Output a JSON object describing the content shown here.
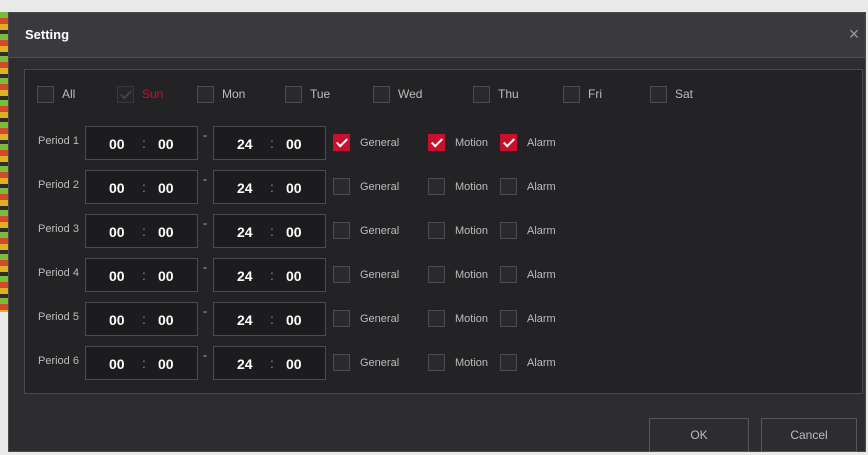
{
  "dialog": {
    "title": "Setting",
    "close_icon": "close-icon"
  },
  "days": [
    {
      "label": "All",
      "checked": false,
      "active": false
    },
    {
      "label": "Sun",
      "checked": true,
      "active": true
    },
    {
      "label": "Mon",
      "checked": false,
      "active": false
    },
    {
      "label": "Tue",
      "checked": false,
      "active": false
    },
    {
      "label": "Wed",
      "checked": false,
      "active": false
    },
    {
      "label": "Thu",
      "checked": false,
      "active": false
    },
    {
      "label": "Fri",
      "checked": false,
      "active": false
    },
    {
      "label": "Sat",
      "checked": false,
      "active": false
    }
  ],
  "periods": [
    {
      "label": "Period 1",
      "start_h": "00",
      "start_m": "00",
      "end_h": "24",
      "end_m": "00",
      "general": true,
      "motion": true,
      "alarm": true
    },
    {
      "label": "Period 2",
      "start_h": "00",
      "start_m": "00",
      "end_h": "24",
      "end_m": "00",
      "general": false,
      "motion": false,
      "alarm": false
    },
    {
      "label": "Period 3",
      "start_h": "00",
      "start_m": "00",
      "end_h": "24",
      "end_m": "00",
      "general": false,
      "motion": false,
      "alarm": false
    },
    {
      "label": "Period 4",
      "start_h": "00",
      "start_m": "00",
      "end_h": "24",
      "end_m": "00",
      "general": false,
      "motion": false,
      "alarm": false
    },
    {
      "label": "Period 5",
      "start_h": "00",
      "start_m": "00",
      "end_h": "24",
      "end_m": "00",
      "general": false,
      "motion": false,
      "alarm": false
    },
    {
      "label": "Period 6",
      "start_h": "00",
      "start_m": "00",
      "end_h": "24",
      "end_m": "00",
      "general": false,
      "motion": false,
      "alarm": false
    }
  ],
  "options": {
    "general": "General",
    "motion": "Motion",
    "alarm": "Alarm"
  },
  "separators": {
    "time": ":",
    "range": "-"
  },
  "buttons": {
    "ok": "OK",
    "cancel": "Cancel"
  },
  "colors": {
    "accent": "#c8102e",
    "background": "#2d2d30",
    "text": "#bcbcbc"
  }
}
